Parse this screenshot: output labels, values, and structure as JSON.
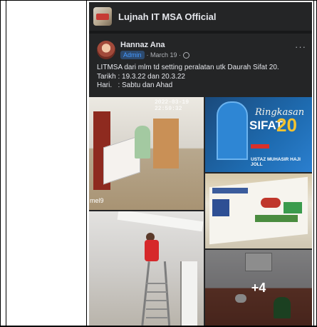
{
  "group": {
    "name": "Lujnah IT MSA Official"
  },
  "post": {
    "author": "Hannaz Ana",
    "badge": "Admin",
    "date": "· March 19 ·",
    "lines": [
      "LITMSA dari mlm td setting peralatan utk Daurah Sifat 20.",
      "Tarikh : 19.3.22 dan 20.3.22",
      "Hari.   : Sabtu dan Ahad"
    ]
  },
  "photos": {
    "p1_cam": "2022-03-19 22:59:32",
    "p1_label": "mel9",
    "p2_script": "Ringkasan",
    "p2_sifat": "SIFAT",
    "p2_num": "20",
    "p2_ustaz": "USTAZ MUHASIR HAJI JOLL",
    "more_count": "+4"
  },
  "colors": {
    "fb_bg": "#18191a",
    "card_bg": "#242526",
    "text": "#e4e6eb",
    "muted": "#b0b3b8",
    "badge": "#4599ff"
  }
}
